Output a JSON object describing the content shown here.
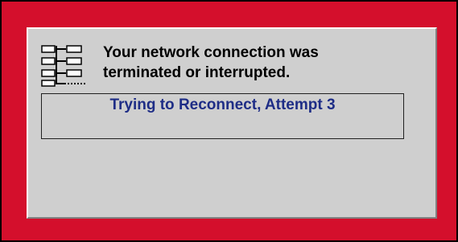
{
  "dialog": {
    "icon": "network-tree-icon",
    "message_line1": "Your network connection was",
    "message_line2": "terminated or interrupted.",
    "status": "Trying to Reconnect, Attempt 3"
  },
  "colors": {
    "frame": "#d40f2c",
    "panel": "#cfcfcf",
    "status_text": "#1e2d86"
  }
}
